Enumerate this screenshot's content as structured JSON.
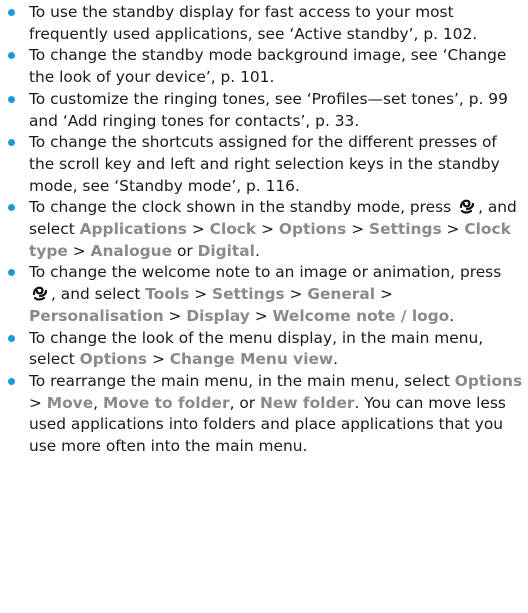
{
  "items": [
    {
      "parts": [
        {
          "t": "To use the standby display for fast access to your most frequently used applications, see ‘Active standby’, p. 102."
        }
      ]
    },
    {
      "parts": [
        {
          "t": "To change the standby mode background image, see ‘Change the look of your device’, p. 101."
        }
      ]
    },
    {
      "parts": [
        {
          "t": "To customize the ringing tones, see ‘Profiles—set tones’, p. 99 and ‘Add ringing tones for contacts’, p. 33."
        }
      ]
    },
    {
      "parts": [
        {
          "t": "To change the shortcuts assigned for the different presses of the scroll key and left and right selection keys in the standby mode, see ‘Standby mode’, p. 116."
        }
      ]
    },
    {
      "parts": [
        {
          "t": "To change the clock shown in the standby mode, press "
        },
        {
          "icon": "menu-key-icon"
        },
        {
          "t": ", and select "
        },
        {
          "k": "Applications"
        },
        {
          "t": " > "
        },
        {
          "k": "Clock"
        },
        {
          "t": " > "
        },
        {
          "k": "Options"
        },
        {
          "t": " > "
        },
        {
          "k": "Settings"
        },
        {
          "t": " > "
        },
        {
          "k": "Clock type"
        },
        {
          "t": " > "
        },
        {
          "k": "Analogue"
        },
        {
          "t": " or "
        },
        {
          "k": "Digital"
        },
        {
          "t": "."
        }
      ]
    },
    {
      "parts": [
        {
          "t": "To change the welcome note to an image or animation, press "
        },
        {
          "icon": "menu-key-icon"
        },
        {
          "t": ", and select "
        },
        {
          "k": "Tools"
        },
        {
          "t": " > "
        },
        {
          "k": "Settings"
        },
        {
          "t": " > "
        },
        {
          "k": "General"
        },
        {
          "t": " > "
        },
        {
          "k": "Personalisation"
        },
        {
          "t": " > "
        },
        {
          "k": "Display"
        },
        {
          "t": " > "
        },
        {
          "k": "Welcome note / logo"
        },
        {
          "t": "."
        }
      ]
    },
    {
      "parts": [
        {
          "t": "To change the look of the menu display, in the main menu, select "
        },
        {
          "k": "Options"
        },
        {
          "t": " > "
        },
        {
          "k": "Change Menu view"
        },
        {
          "t": "."
        }
      ]
    },
    {
      "parts": [
        {
          "t": "To rearrange the main menu, in the main menu, select "
        },
        {
          "k": "Options"
        },
        {
          "t": " > "
        },
        {
          "k": "Move"
        },
        {
          "t": ", "
        },
        {
          "k": "Move to folder"
        },
        {
          "t": ", or "
        },
        {
          "k": "New folder"
        },
        {
          "t": ". You can move less used applications into folders and place applications that you use more often into the main menu."
        }
      ]
    }
  ],
  "colors": {
    "bullet": "#1f9ad6",
    "keyword": "#8a8a8a",
    "text": "#1a1a1a"
  }
}
